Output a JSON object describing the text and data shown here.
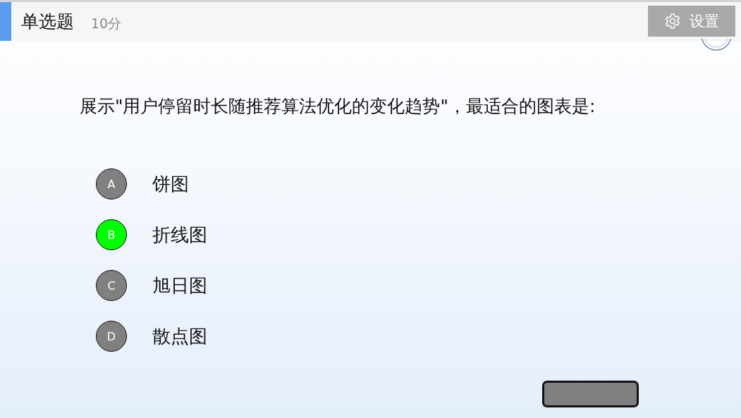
{
  "header": {
    "title": "单选题",
    "score": "10分",
    "settings_button": "设置"
  },
  "question": "展示\"用户停留时长随推荐算法优化的变化趋势\"，最适合的图表是:",
  "options": [
    {
      "letter": "A",
      "label": "饼图",
      "selected": false
    },
    {
      "letter": "B",
      "label": "折线图",
      "selected": true
    },
    {
      "letter": "C",
      "label": "旭日图",
      "selected": false
    },
    {
      "letter": "D",
      "label": "散点图",
      "selected": false
    }
  ]
}
